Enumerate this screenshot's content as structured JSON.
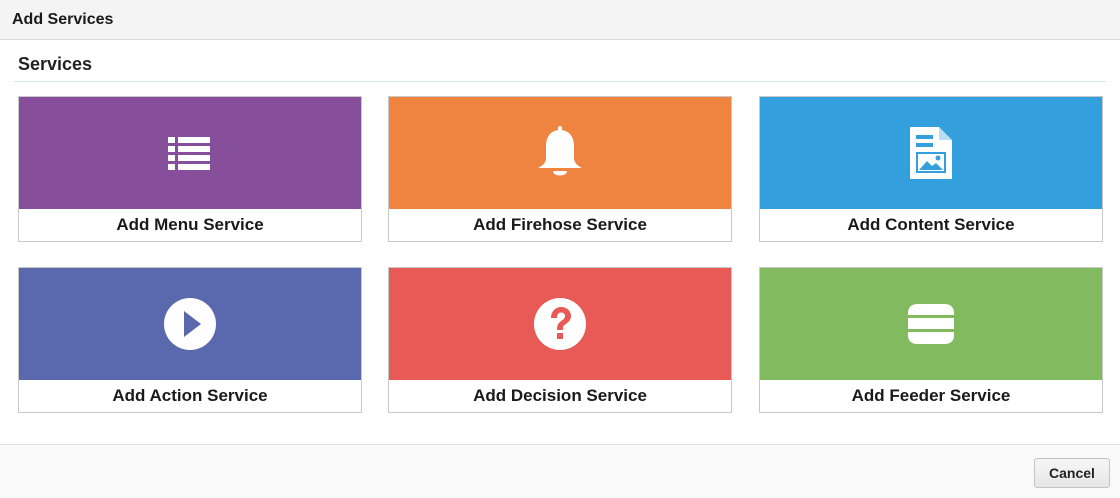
{
  "dialog": {
    "title": "Add Services"
  },
  "section": {
    "title": "Services"
  },
  "tiles": [
    {
      "label": "Add Menu Service",
      "color": "#874e9c",
      "icon": "list-icon"
    },
    {
      "label": "Add Firehose Service",
      "color": "#ee8440",
      "icon": "bell-icon"
    },
    {
      "label": "Add Content Service",
      "color": "#33a0dd",
      "icon": "document-image-icon"
    },
    {
      "label": "Add Action Service",
      "color": "#5a69ae",
      "icon": "play-circle-icon"
    },
    {
      "label": "Add Decision Service",
      "color": "#e85a55",
      "icon": "question-circle-icon"
    },
    {
      "label": "Add Feeder Service",
      "color": "#82bb5f",
      "icon": "stack-icon"
    }
  ],
  "footer": {
    "cancel_label": "Cancel"
  }
}
